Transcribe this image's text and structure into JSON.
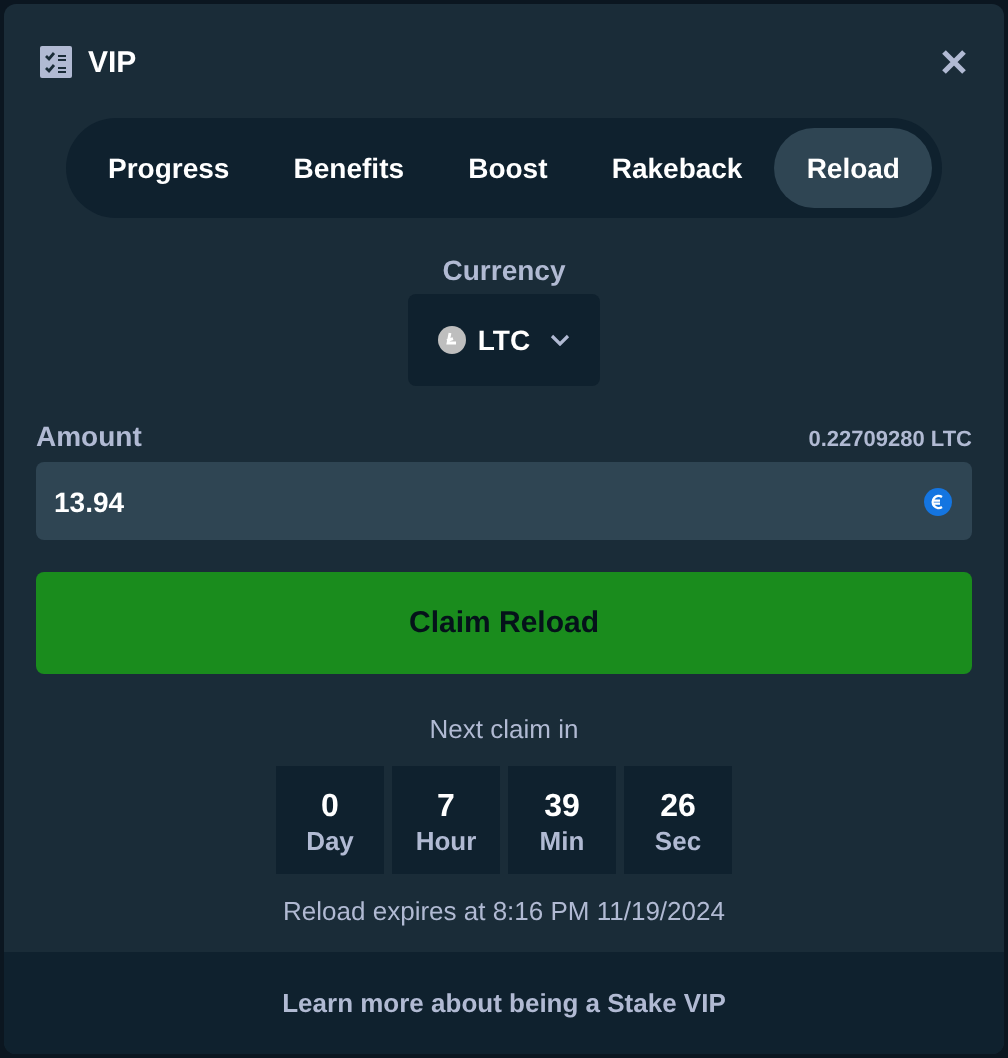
{
  "window": {
    "title": "VIP"
  },
  "tabs": [
    {
      "label": "Progress",
      "selected": false
    },
    {
      "label": "Benefits",
      "selected": false
    },
    {
      "label": "Boost",
      "selected": false
    },
    {
      "label": "Rakeback",
      "selected": false
    },
    {
      "label": "Reload",
      "selected": true
    }
  ],
  "currency": {
    "label": "Currency",
    "value": "LTC"
  },
  "amount": {
    "label": "Amount",
    "balance": "0.22709280 LTC",
    "value": "13.94"
  },
  "claim_button": "Claim Reload",
  "next_claim": {
    "label": "Next claim in",
    "units": [
      {
        "value": "0",
        "unit": "Day"
      },
      {
        "value": "7",
        "unit": "Hour"
      },
      {
        "value": "39",
        "unit": "Min"
      },
      {
        "value": "26",
        "unit": "Sec"
      }
    ]
  },
  "expires": "Reload expires at 8:16 PM 11/19/2024",
  "footer_link": "Learn more about being a Stake VIP"
}
